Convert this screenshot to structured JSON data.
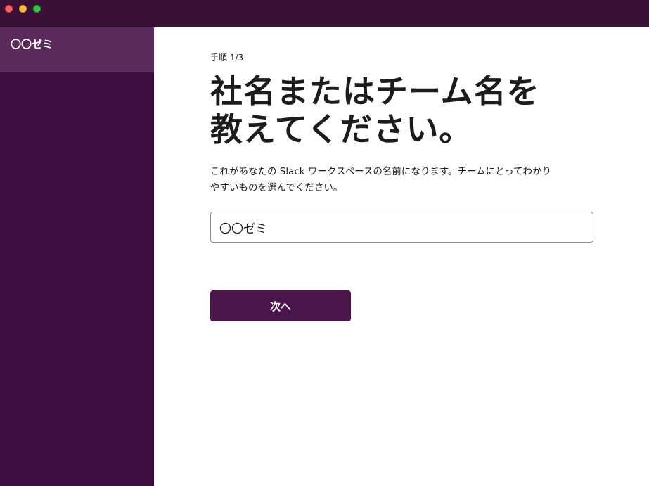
{
  "window": {
    "controls": [
      "close",
      "minimize",
      "maximize"
    ]
  },
  "sidebar": {
    "workspace_name": "〇〇ゼミ"
  },
  "main": {
    "step": "手順 1/3",
    "heading_line1": "社名またはチーム名を",
    "heading_line2": "教えてください。",
    "description_line1": "これがあなたの Slack ワークスペースの名前になります。チームにとってわかり",
    "description_line2": "やすいものを選んでください。",
    "input_value": "〇〇ゼミ",
    "next_button": "次へ"
  },
  "colors": {
    "sidebar_bg": "#3f0e40",
    "active_item": "#5a2a5b",
    "primary_button": "#4a154b"
  }
}
